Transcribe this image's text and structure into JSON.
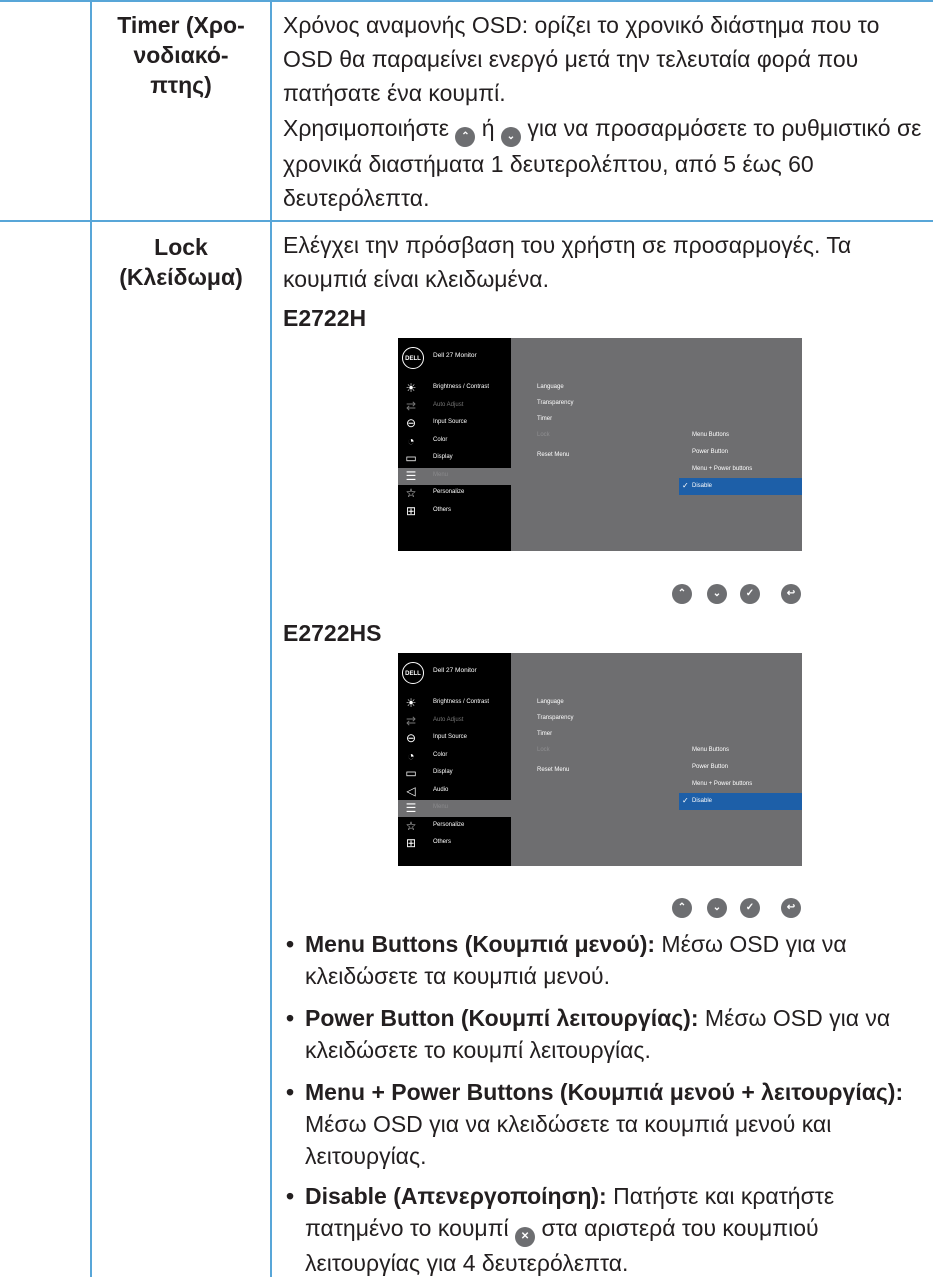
{
  "timer": {
    "label": "Timer (Χρο-\nνοδιακό-\nπτης)",
    "desc1": "Χρόνος αναμονής OSD: ορίζει το χρονικό διάστημα που το OSD θα παραμείνει ενεργό μετά την τελευταία φορά που πατήσατε ένα κουμπί.",
    "desc2_a": "Χρησιμοποιήστε",
    "desc2_b": "ή",
    "desc2_c": "για να προσαρμόσετε το ρυθμιστικό σε χρονικά διαστήματα 1 δευτερολέπτου, από 5 έως 60 δευτερόλεπτα."
  },
  "lock": {
    "label": "Lock\n(Κλείδωμα)",
    "desc": "Ελέγχει την πρόσβαση του χρήστη σε προσαρμογές. Τα κουμπιά είναι κλειδωμένα."
  },
  "osd_a": {
    "model": "E2722H",
    "logo": "DELL",
    "title": "Dell 27 Monitor",
    "menu": [
      {
        "label": "Brightness / Contrast",
        "icon": "☀",
        "name": "brightness-icon"
      },
      {
        "label": "Auto Adjust",
        "icon": "⇄",
        "name": "auto-adjust-icon"
      },
      {
        "label": "Input Source",
        "icon": "⊖",
        "name": "input-source-icon"
      },
      {
        "label": "Color",
        "icon": "◔",
        "name": "color-icon"
      },
      {
        "label": "Display",
        "icon": "▭",
        "name": "display-icon"
      },
      {
        "label": "Menu",
        "icon": "☰",
        "name": "menu-icon"
      },
      {
        "label": "Personalize",
        "icon": "☆",
        "name": "star-icon"
      },
      {
        "label": "Others",
        "icon": "⊞",
        "name": "others-icon"
      }
    ],
    "submenu": [
      "Language",
      "Transparency",
      "Timer",
      "Lock",
      "Reset Menu"
    ],
    "options": [
      "Menu Buttons",
      "Power Button",
      "Menu + Power buttons",
      "Disable"
    ],
    "check": "✓"
  },
  "osd_b": {
    "model": "E2722HS",
    "logo": "DELL",
    "title": "Dell 27 Monitor",
    "menu": [
      {
        "label": "Brightness / Contrast",
        "icon": "☀",
        "name": "brightness-icon"
      },
      {
        "label": "Auto Adjust",
        "icon": "⇄",
        "name": "auto-adjust-icon"
      },
      {
        "label": "Input Source",
        "icon": "⊖",
        "name": "input-source-icon"
      },
      {
        "label": "Color",
        "icon": "◔",
        "name": "color-icon"
      },
      {
        "label": "Display",
        "icon": "▭",
        "name": "display-icon"
      },
      {
        "label": "Audio",
        "icon": "◁",
        "name": "audio-icon"
      },
      {
        "label": "Menu",
        "icon": "☰",
        "name": "menu-icon"
      },
      {
        "label": "Personalize",
        "icon": "☆",
        "name": "star-icon"
      },
      {
        "label": "Others",
        "icon": "⊞",
        "name": "others-icon"
      }
    ],
    "submenu": [
      "Language",
      "Transparency",
      "Timer",
      "Lock",
      "Reset Menu"
    ],
    "options": [
      "Menu Buttons",
      "Power Button",
      "Menu + Power buttons",
      "Disable"
    ],
    "check": "✓"
  },
  "button_icons": {
    "up": "⌃",
    "down": "⌄",
    "ok": "✓",
    "back": "↩",
    "close": "✕"
  },
  "bullets": {
    "b1_bold": "Menu Buttons (Κουμπιά μενού):",
    "b1_text": " Μέσω OSD για να κλειδώσετε τα κουμπιά μενού.",
    "b2_bold": "Power Button (Κουμπί λειτουργίας):",
    "b2_text": " Μέσω OSD για να κλειδώσετε το κουμπί λειτουργίας.",
    "b3_bold": "Menu + Power Buttons (Κουμπιά μενού + λειτουργίας):",
    "b3_text": " Μέσω OSD για να κλειδώσετε τα κουμπιά μενού και λειτουργίας.",
    "b4_bold": "Disable (Απενεργοποίηση):",
    "b4_text_a": " Πατήστε και κρατήστε πατημένο το κουμπί",
    "b4_text_b": "στα αριστερά του κουμπιού λειτουργίας για 4 δευτερόλεπτα.",
    "dot": "•"
  },
  "colors": {
    "rule": "#58a6d8",
    "osd_panel": "#6e6e70",
    "osd_select": "#1d5fa8",
    "button": "#6d6e71"
  }
}
